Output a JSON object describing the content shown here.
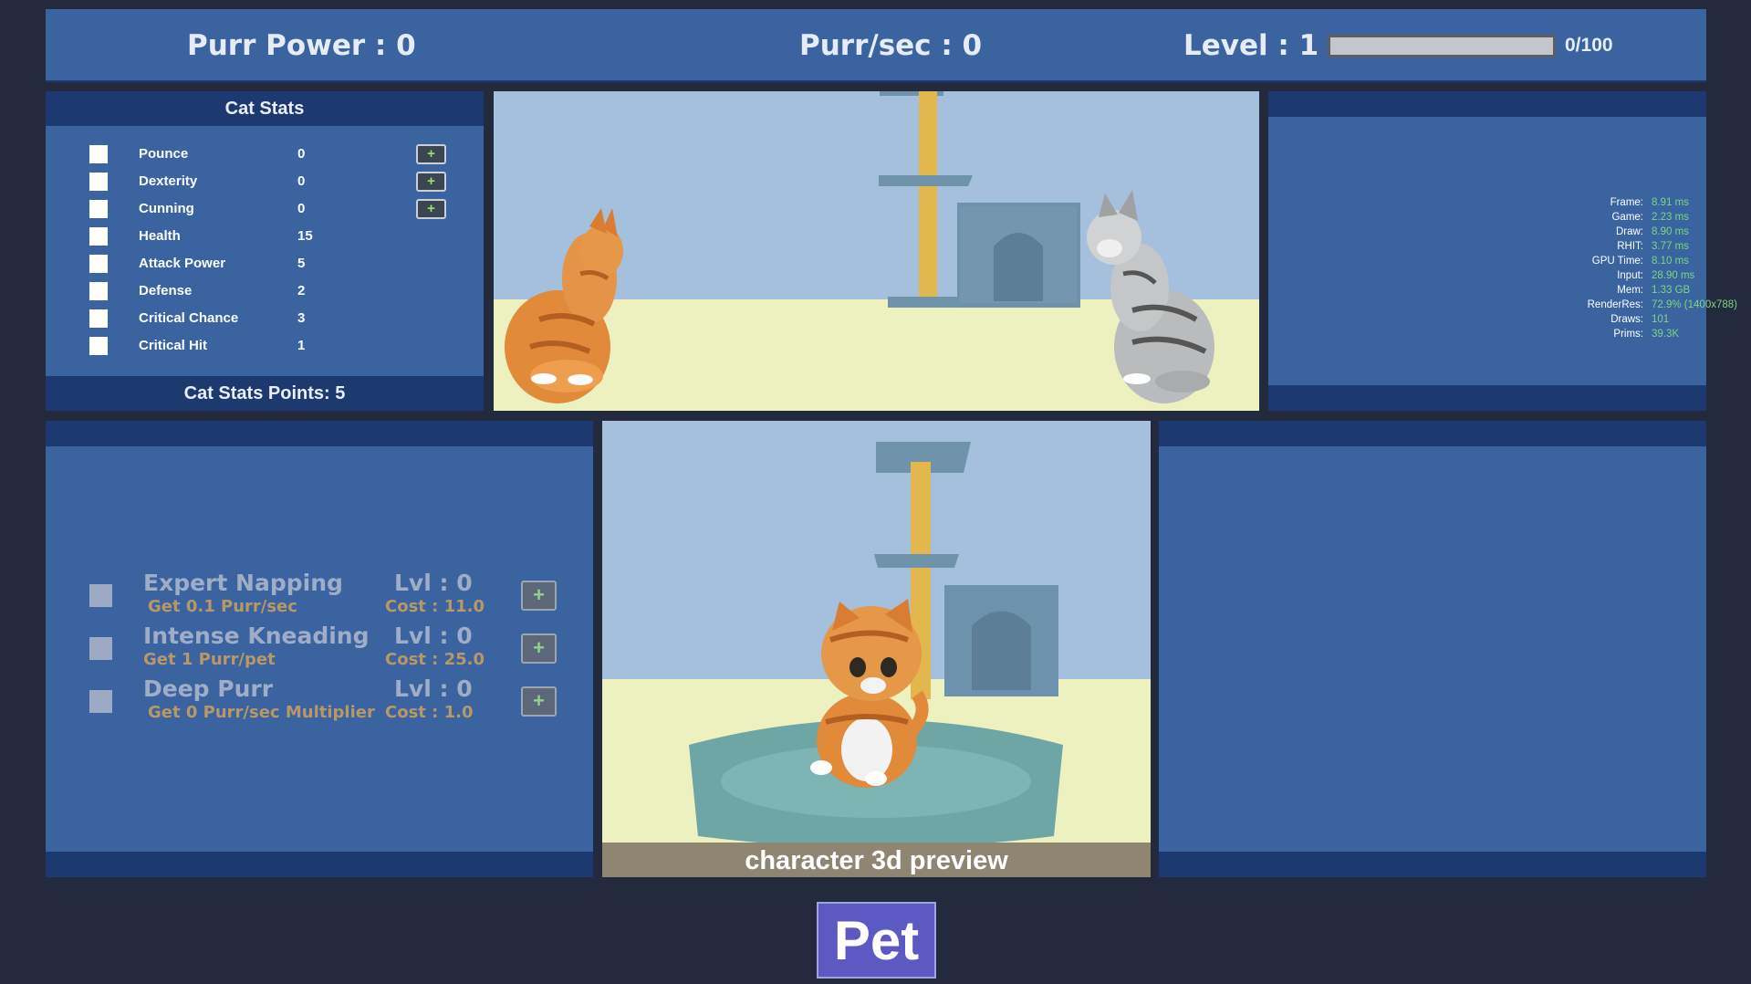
{
  "hud": {
    "purr_power": "Purr Power : 0",
    "purr_per_sec": "Purr/sec : 0",
    "level": "Level : 1",
    "xp_text": "0/100",
    "xp_progress": 0
  },
  "cat_stats": {
    "title": "Cat Stats",
    "points": "Cat Stats Points: 5",
    "rows": [
      {
        "label": "Pounce",
        "value": "0",
        "plus": "+"
      },
      {
        "label": "Dexterity",
        "value": "0",
        "plus": "+"
      },
      {
        "label": "Cunning",
        "value": "0",
        "plus": "+"
      },
      {
        "label": "Health",
        "value": "15"
      },
      {
        "label": "Attack Power",
        "value": "5"
      },
      {
        "label": "Defense",
        "value": "2"
      },
      {
        "label": "Critical Chance",
        "value": "3"
      },
      {
        "label": "Critical Hit",
        "value": "1"
      }
    ]
  },
  "perf": [
    {
      "k": "Frame:",
      "v": "8.91 ms"
    },
    {
      "k": "Game:",
      "v": "2.23 ms"
    },
    {
      "k": "Draw:",
      "v": "8.90 ms"
    },
    {
      "k": "RHIT:",
      "v": "3.77 ms"
    },
    {
      "k": "GPU Time:",
      "v": "8.10 ms"
    },
    {
      "k": "Input:",
      "v": "28.90 ms"
    },
    {
      "k": "Mem:",
      "v": "1.33 GB"
    },
    {
      "k": "RenderRes:",
      "v": "72.9% (1400x788)"
    },
    {
      "k": "Draws:",
      "v": "101"
    },
    {
      "k": "Prims:",
      "v": "39.3K"
    }
  ],
  "upgrades": [
    {
      "name": "Expert Napping",
      "desc": "Get 0.1 Purr/sec",
      "lvl": "Lvl : 0",
      "cost": "Cost : 11.0",
      "plus": "+"
    },
    {
      "name": "Intense Kneading",
      "desc": "Get 1 Purr/pet",
      "lvl": "Lvl : 0",
      "cost": "Cost : 25.0",
      "plus": "+"
    },
    {
      "name": "Deep Purr",
      "desc": "Get 0 Purr/sec Multiplier",
      "lvl": "Lvl : 0",
      "cost": "Cost : 1.0",
      "plus": "+"
    }
  ],
  "preview_label": "character 3d preview",
  "pet_button": "Pet",
  "colors": {
    "panel": "#3a63a0",
    "panel_dark": "#1c3a70",
    "background": "#232a3d",
    "sky": "#a4c0dc",
    "floor": "#edf1c0",
    "tabby_orange": "#e08a3a",
    "pet_button": "#5b59c2"
  }
}
